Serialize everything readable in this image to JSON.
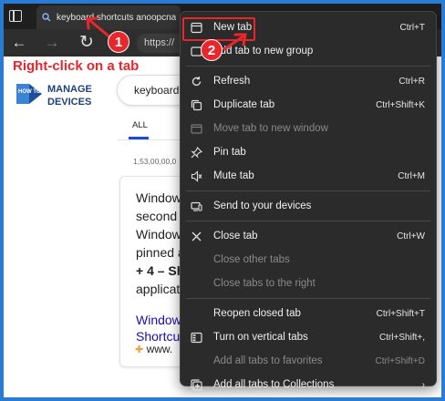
{
  "browser": {
    "active_tab_title": "keyboard shortcuts anoopcna",
    "url_text": "https://"
  },
  "page": {
    "logo_line1": "HOW TO",
    "logo_line2_a": "MANAGE",
    "logo_line2_b": "DEVICES",
    "search_value": "keyboard",
    "tab_all": "ALL",
    "results_count": "1,53,00,00,0",
    "snippet_lines": [
      "Window",
      "second",
      "Window",
      "pinned a",
      "+ 4 – Sh",
      "applicat"
    ],
    "link_lines": [
      "Window",
      "Shortcu"
    ],
    "site": "www."
  },
  "annotations": {
    "instruction": "Right-click on a tab",
    "step1": "1",
    "step2": "2",
    "color": "#e8262b"
  },
  "menu": {
    "groups": [
      [
        {
          "label": "New tab",
          "shortcut": "Ctrl+T",
          "icon": "new-tab-icon",
          "disabled": false
        },
        {
          "label": "Add tab to new group",
          "shortcut": "",
          "icon": "tab-group-icon",
          "disabled": false
        }
      ],
      [
        {
          "label": "Refresh",
          "shortcut": "Ctrl+R",
          "icon": "refresh-icon",
          "disabled": false
        },
        {
          "label": "Duplicate tab",
          "shortcut": "Ctrl+Shift+K",
          "icon": "duplicate-icon",
          "disabled": false
        },
        {
          "label": "Move tab to new window",
          "shortcut": "",
          "icon": "move-window-icon",
          "disabled": true
        },
        {
          "label": "Pin tab",
          "shortcut": "",
          "icon": "pin-icon",
          "disabled": false
        },
        {
          "label": "Mute tab",
          "shortcut": "Ctrl+M",
          "icon": "mute-icon",
          "disabled": false
        }
      ],
      [
        {
          "label": "Send to your devices",
          "shortcut": "",
          "icon": "send-devices-icon",
          "disabled": false
        }
      ],
      [
        {
          "label": "Close tab",
          "shortcut": "Ctrl+W",
          "icon": "close-icon",
          "disabled": false
        },
        {
          "label": "Close other tabs",
          "shortcut": "",
          "icon": "",
          "disabled": true
        },
        {
          "label": "Close tabs to the right",
          "shortcut": "",
          "icon": "",
          "disabled": true
        }
      ],
      [
        {
          "label": "Reopen closed tab",
          "shortcut": "Ctrl+Shift+T",
          "icon": "",
          "disabled": false
        },
        {
          "label": "Turn on vertical tabs",
          "shortcut": "Ctrl+Shift+,",
          "icon": "vertical-tabs-icon",
          "disabled": false
        },
        {
          "label": "Add all tabs to favorites",
          "shortcut": "Ctrl+Shift+D",
          "icon": "",
          "disabled": true
        },
        {
          "label": "Add all tabs to Collections",
          "shortcut": "›",
          "icon": "collections-icon",
          "disabled": false
        }
      ]
    ]
  }
}
